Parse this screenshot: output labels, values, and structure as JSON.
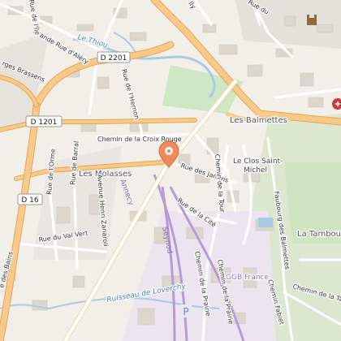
{
  "map": {
    "labels": {
      "grande_rue_alery": "Grande Rue d'Aléry",
      "le_thiou": "Le Thiou",
      "brassens": "rges Brassens",
      "rue_ile": "Rue de l'Île",
      "lly": "lly",
      "rue_du": "Rue du",
      "rue_derno": "Rue de l'Herno",
      "rue_lhernon": "Rue de l'Hernon",
      "chemin_croix_rouge": "Chemin de la Croix Rouge",
      "les_balmettes": "Les Balmettes",
      "les_molasses": "Les Molasses",
      "rue_des_jardins": "Rue des Jardins",
      "le_clos_saint_michel_1": "Le Clos Saint-",
      "le_clos_saint_michel_2": "Michel",
      "rue_de_lorme": "Rue de l'Orme",
      "rue_de_barral": "Rue de Barral",
      "avenue_henri_zanaroli": "Avenue Henri Zanaroli",
      "annecy": "Annecy",
      "rue_de_la_cite": "Rue de la Cité",
      "chemin_de_la_tour": "Chemin de la Tour",
      "faubourg_balmettes": "Faubourg des Balmettes",
      "la_tambour": "La Tambou",
      "rue_du_val_vert": "Rue du Val Vert",
      "route_des_bains": "e des Bains",
      "seynod": "Seynod",
      "ruisseau_loverchy": "Ruisseau de Loverchy",
      "ggb_france": "GGB France",
      "chemin_de_la_prairie": "Chemin de la Prairie",
      "chemin_de_la_prairie2": "Chemin de la Prairie",
      "chemin_fabiet": "Chemin Fabiet",
      "chemin_de_la_tambourne": "Chemin de la Tambourne"
    },
    "shields": {
      "d2201": "D 2201",
      "d1201": "D 1201",
      "d16": "D 16"
    },
    "parking_label": "P",
    "colors": {
      "background": "#f2efe9",
      "primary_road": "#f7c98b",
      "railway": "#b89ad8",
      "water": "#a9cbe6",
      "park": "#cde8c3",
      "marker": "#f08a5d"
    }
  }
}
